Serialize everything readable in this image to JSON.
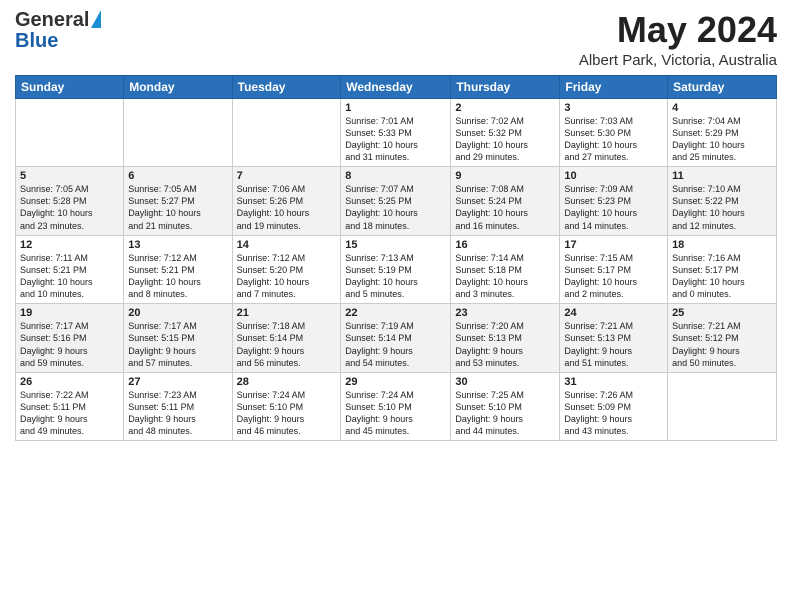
{
  "logo": {
    "general": "General",
    "blue": "Blue"
  },
  "title": {
    "month_year": "May 2024",
    "location": "Albert Park, Victoria, Australia"
  },
  "headers": [
    "Sunday",
    "Monday",
    "Tuesday",
    "Wednesday",
    "Thursday",
    "Friday",
    "Saturday"
  ],
  "weeks": [
    [
      {
        "day": "",
        "info": ""
      },
      {
        "day": "",
        "info": ""
      },
      {
        "day": "",
        "info": ""
      },
      {
        "day": "1",
        "info": "Sunrise: 7:01 AM\nSunset: 5:33 PM\nDaylight: 10 hours\nand 31 minutes."
      },
      {
        "day": "2",
        "info": "Sunrise: 7:02 AM\nSunset: 5:32 PM\nDaylight: 10 hours\nand 29 minutes."
      },
      {
        "day": "3",
        "info": "Sunrise: 7:03 AM\nSunset: 5:30 PM\nDaylight: 10 hours\nand 27 minutes."
      },
      {
        "day": "4",
        "info": "Sunrise: 7:04 AM\nSunset: 5:29 PM\nDaylight: 10 hours\nand 25 minutes."
      }
    ],
    [
      {
        "day": "5",
        "info": "Sunrise: 7:05 AM\nSunset: 5:28 PM\nDaylight: 10 hours\nand 23 minutes."
      },
      {
        "day": "6",
        "info": "Sunrise: 7:05 AM\nSunset: 5:27 PM\nDaylight: 10 hours\nand 21 minutes."
      },
      {
        "day": "7",
        "info": "Sunrise: 7:06 AM\nSunset: 5:26 PM\nDaylight: 10 hours\nand 19 minutes."
      },
      {
        "day": "8",
        "info": "Sunrise: 7:07 AM\nSunset: 5:25 PM\nDaylight: 10 hours\nand 18 minutes."
      },
      {
        "day": "9",
        "info": "Sunrise: 7:08 AM\nSunset: 5:24 PM\nDaylight: 10 hours\nand 16 minutes."
      },
      {
        "day": "10",
        "info": "Sunrise: 7:09 AM\nSunset: 5:23 PM\nDaylight: 10 hours\nand 14 minutes."
      },
      {
        "day": "11",
        "info": "Sunrise: 7:10 AM\nSunset: 5:22 PM\nDaylight: 10 hours\nand 12 minutes."
      }
    ],
    [
      {
        "day": "12",
        "info": "Sunrise: 7:11 AM\nSunset: 5:21 PM\nDaylight: 10 hours\nand 10 minutes."
      },
      {
        "day": "13",
        "info": "Sunrise: 7:12 AM\nSunset: 5:21 PM\nDaylight: 10 hours\nand 8 minutes."
      },
      {
        "day": "14",
        "info": "Sunrise: 7:12 AM\nSunset: 5:20 PM\nDaylight: 10 hours\nand 7 minutes."
      },
      {
        "day": "15",
        "info": "Sunrise: 7:13 AM\nSunset: 5:19 PM\nDaylight: 10 hours\nand 5 minutes."
      },
      {
        "day": "16",
        "info": "Sunrise: 7:14 AM\nSunset: 5:18 PM\nDaylight: 10 hours\nand 3 minutes."
      },
      {
        "day": "17",
        "info": "Sunrise: 7:15 AM\nSunset: 5:17 PM\nDaylight: 10 hours\nand 2 minutes."
      },
      {
        "day": "18",
        "info": "Sunrise: 7:16 AM\nSunset: 5:17 PM\nDaylight: 10 hours\nand 0 minutes."
      }
    ],
    [
      {
        "day": "19",
        "info": "Sunrise: 7:17 AM\nSunset: 5:16 PM\nDaylight: 9 hours\nand 59 minutes."
      },
      {
        "day": "20",
        "info": "Sunrise: 7:17 AM\nSunset: 5:15 PM\nDaylight: 9 hours\nand 57 minutes."
      },
      {
        "day": "21",
        "info": "Sunrise: 7:18 AM\nSunset: 5:14 PM\nDaylight: 9 hours\nand 56 minutes."
      },
      {
        "day": "22",
        "info": "Sunrise: 7:19 AM\nSunset: 5:14 PM\nDaylight: 9 hours\nand 54 minutes."
      },
      {
        "day": "23",
        "info": "Sunrise: 7:20 AM\nSunset: 5:13 PM\nDaylight: 9 hours\nand 53 minutes."
      },
      {
        "day": "24",
        "info": "Sunrise: 7:21 AM\nSunset: 5:13 PM\nDaylight: 9 hours\nand 51 minutes."
      },
      {
        "day": "25",
        "info": "Sunrise: 7:21 AM\nSunset: 5:12 PM\nDaylight: 9 hours\nand 50 minutes."
      }
    ],
    [
      {
        "day": "26",
        "info": "Sunrise: 7:22 AM\nSunset: 5:11 PM\nDaylight: 9 hours\nand 49 minutes."
      },
      {
        "day": "27",
        "info": "Sunrise: 7:23 AM\nSunset: 5:11 PM\nDaylight: 9 hours\nand 48 minutes."
      },
      {
        "day": "28",
        "info": "Sunrise: 7:24 AM\nSunset: 5:10 PM\nDaylight: 9 hours\nand 46 minutes."
      },
      {
        "day": "29",
        "info": "Sunrise: 7:24 AM\nSunset: 5:10 PM\nDaylight: 9 hours\nand 45 minutes."
      },
      {
        "day": "30",
        "info": "Sunrise: 7:25 AM\nSunset: 5:10 PM\nDaylight: 9 hours\nand 44 minutes."
      },
      {
        "day": "31",
        "info": "Sunrise: 7:26 AM\nSunset: 5:09 PM\nDaylight: 9 hours\nand 43 minutes."
      },
      {
        "day": "",
        "info": ""
      }
    ]
  ]
}
